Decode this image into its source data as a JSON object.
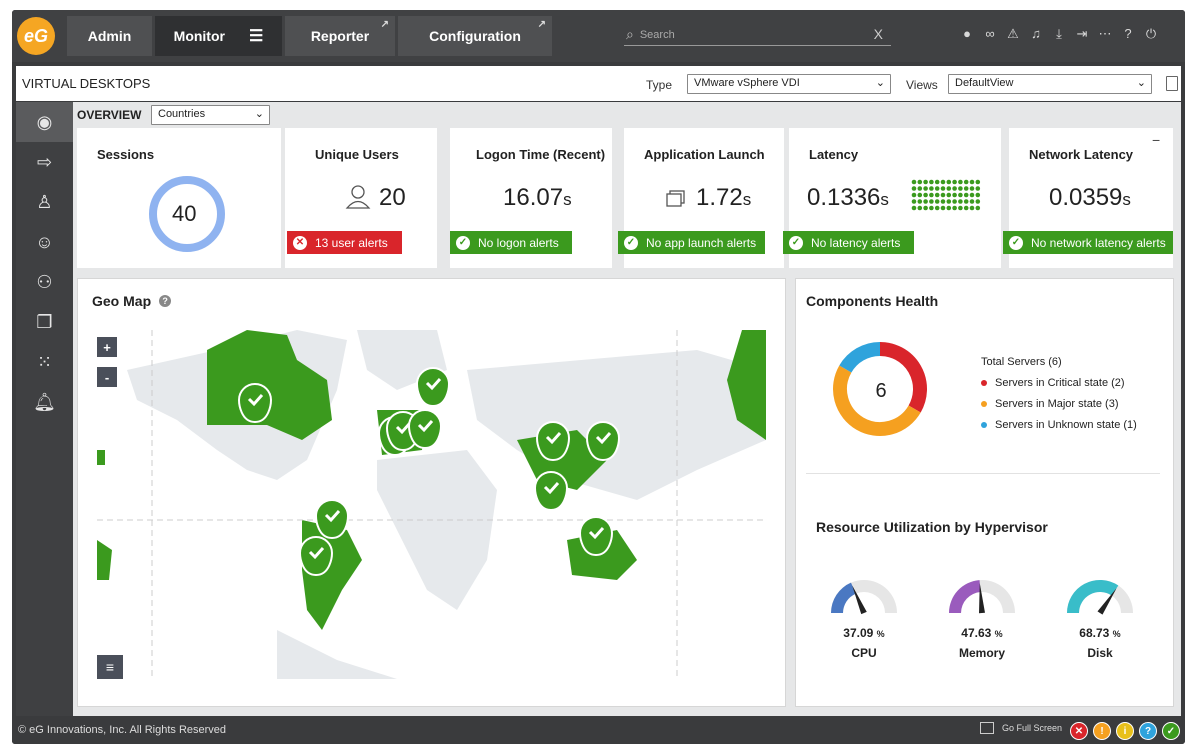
{
  "topbar": {
    "logo_text": "eG",
    "tabs": [
      {
        "label": "Admin"
      },
      {
        "label": "Monitor"
      },
      {
        "label": "Reporter"
      },
      {
        "label": "Configuration"
      }
    ],
    "search": {
      "placeholder": "Search",
      "clear_glyph": "X"
    },
    "icons": [
      "user-icon",
      "link-icon",
      "warning-icon",
      "bell-icon",
      "download-icon",
      "login-icon",
      "more-icon",
      "help-icon",
      "power-icon"
    ]
  },
  "header": {
    "title": "VIRTUAL DESKTOPS",
    "type_label": "Type",
    "type_value": "VMware vSphere VDI",
    "views_label": "Views",
    "views_value": "DefaultView"
  },
  "sidebar": {
    "items": [
      "eye-icon",
      "login-arrow-icon",
      "user-desk-icon",
      "users-icon",
      "org-chart-icon",
      "windows-icon",
      "grid-icon",
      "bell-icon"
    ]
  },
  "overview": {
    "label": "OVERVIEW",
    "filter_value": "Countries"
  },
  "cards": {
    "sessions": {
      "title": "Sessions",
      "value": "40"
    },
    "users": {
      "title": "Unique Users",
      "value": "20",
      "alert": "13 user alerts"
    },
    "logon": {
      "title": "Logon Time (Recent)",
      "value": "16.07",
      "unit": "s",
      "alert": "No logon alerts"
    },
    "app": {
      "title": "Application Launch",
      "value": "1.72",
      "unit": "s",
      "alert": "No app launch alerts"
    },
    "latency": {
      "title": "Latency",
      "value": "0.1336",
      "unit": "s",
      "alert": "No latency alerts"
    },
    "network": {
      "title": "Network Latency",
      "value": "0.0359",
      "unit": "s",
      "alert": "No network latency alerts"
    },
    "collapse_glyph": "−"
  },
  "geomap": {
    "title": "Geo Map",
    "help_glyph": "?",
    "zoom_in": "+",
    "zoom_out": "-"
  },
  "health": {
    "title": "Components Health",
    "total": "6",
    "legend_title": "Total Servers (6)",
    "legend": [
      {
        "label": "Servers in Critical state (2)",
        "color": "#d9252b",
        "count": 2
      },
      {
        "label": "Servers in Major state (3)",
        "color": "#f5a020",
        "count": 3
      },
      {
        "label": "Servers in Unknown state (1)",
        "color": "#2fa3dc",
        "count": 1
      }
    ]
  },
  "resource": {
    "title": "Resource Utilization by Hypervisor",
    "gauges": [
      {
        "label": "CPU",
        "value": "37.09",
        "pct": 37.09,
        "unit": "%",
        "color": "#4a78c2"
      },
      {
        "label": "Memory",
        "value": "47.63",
        "pct": 47.63,
        "unit": "%",
        "color": "#9a5bbd"
      },
      {
        "label": "Disk",
        "value": "68.73",
        "pct": 68.73,
        "unit": "%",
        "color": "#39bdc9"
      }
    ]
  },
  "footer": {
    "copyright": "© eG Innovations, Inc. All Rights Reserved",
    "fullscreen": "Go Full Screen",
    "status_buttons": [
      {
        "glyph": "✕",
        "color": "#d9252b"
      },
      {
        "glyph": "!",
        "color": "#f5a020"
      },
      {
        "glyph": "i",
        "color": "#e8c01a"
      },
      {
        "glyph": "?",
        "color": "#2fa3dc"
      },
      {
        "glyph": "✓",
        "color": "#3b9a1e"
      }
    ]
  }
}
